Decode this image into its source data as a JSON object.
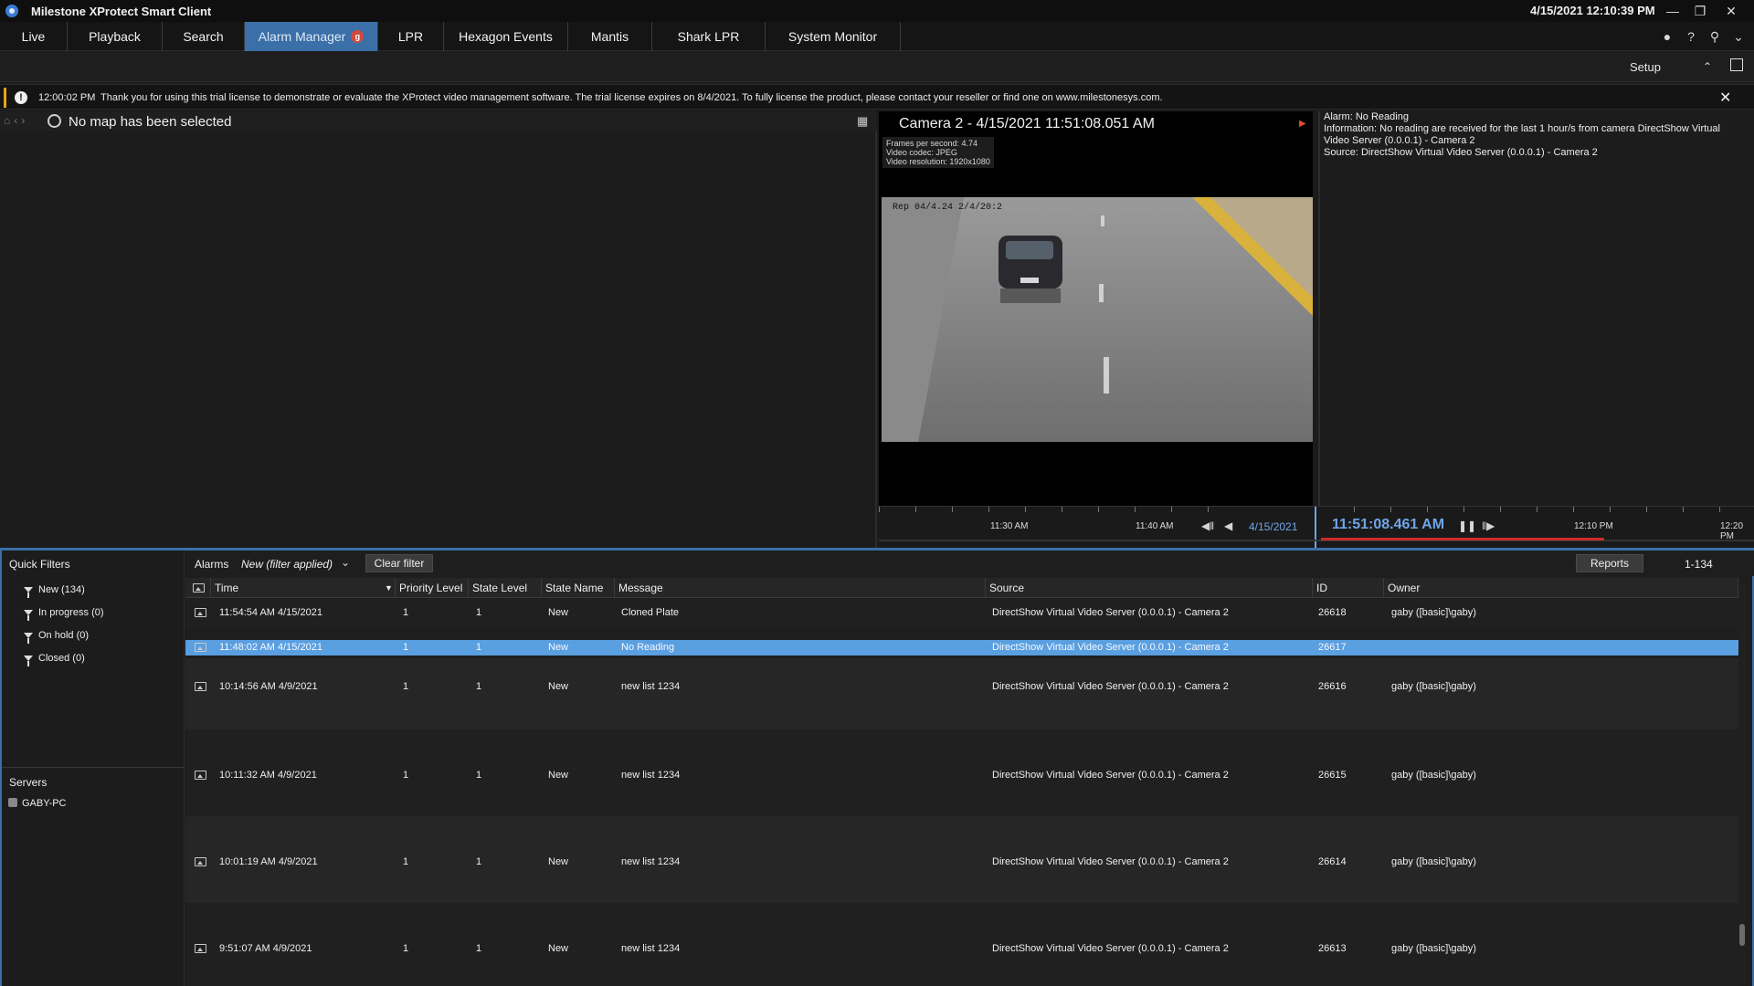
{
  "titlebar": {
    "title": "Milestone XProtect Smart Client",
    "clock": "4/15/2021 12:10:39 PM"
  },
  "tabs": [
    {
      "label": "Live"
    },
    {
      "label": "Playback"
    },
    {
      "label": "Search"
    },
    {
      "label": "Alarm Manager",
      "badge": "g"
    },
    {
      "label": "LPR"
    },
    {
      "label": "Hexagon Events"
    },
    {
      "label": "Mantis"
    },
    {
      "label": "Shark LPR"
    },
    {
      "label": "System Monitor"
    }
  ],
  "setup": {
    "label": "Setup"
  },
  "notification": {
    "time": "12:00:02 PM",
    "message": "Thank you for using this trial license to demonstrate or evaluate the XProtect video management software. The trial license expires on 8/4/2021. To fully license the product, please contact your reseller or find one on www.milestonesys.com."
  },
  "map": {
    "title": "No map has been selected"
  },
  "camera": {
    "title": "Camera 2 - 4/15/2021 11:51:08.051 AM",
    "fps": "Frames per second: 4.74",
    "codec": "Video codec: JPEG",
    "resolution": "Video resolution: 1920x1080",
    "overlay_text": "Rep 04/4.24 2/4/20:2"
  },
  "alarm_detail": {
    "line1": "Alarm: No Reading",
    "line2": "Information: No reading are received for the last 1 hour/s from camera DirectShow Virtual",
    "line3": "Video Server (0.0.0.1) - Camera 2",
    "line4": "Source: DirectShow Virtual Video Server (0.0.0.1) - Camera 2"
  },
  "timeline": {
    "labels": [
      "11:30 AM",
      "11:40 AM",
      "12:10 PM",
      "12:20 PM"
    ],
    "date": "4/15/2021",
    "current": "11:51:08.461 AM"
  },
  "quick_filters": {
    "title": "Quick Filters",
    "items": [
      "New (134)",
      "In progress (0)",
      "On hold (0)",
      "Closed (0)"
    ]
  },
  "servers": {
    "title": "Servers",
    "items": [
      "GABY-PC"
    ]
  },
  "alarm_toolbar": {
    "alarms_label": "Alarms",
    "filter_value": "New (filter applied)",
    "clear_filter": "Clear filter",
    "reports": "Reports",
    "range": "1-134"
  },
  "columns": [
    "Time",
    "Priority Level",
    "State Level",
    "State Name",
    "Message",
    "Source",
    "ID",
    "Owner"
  ],
  "rows": [
    {
      "time": "11:54:54 AM 4/15/2021",
      "priority": "1",
      "state_level": "1",
      "state_name": "New",
      "message": "Cloned Plate",
      "source": "DirectShow Virtual Video Server (0.0.0.1) - Camera 2",
      "id": "26618",
      "owner": "gaby ([basic]\\gaby)"
    },
    {
      "time": "11:48:02 AM 4/15/2021",
      "priority": "1",
      "state_level": "1",
      "state_name": "New",
      "message": "No Reading",
      "source": "DirectShow Virtual Video Server (0.0.0.1) - Camera 2",
      "id": "26617",
      "owner": ""
    },
    {
      "time": "10:14:56 AM 4/9/2021",
      "priority": "1",
      "state_level": "1",
      "state_name": "New",
      "message": "new list 1234",
      "source": "DirectShow Virtual Video Server (0.0.0.1) - Camera 2",
      "id": "26616",
      "owner": "gaby ([basic]\\gaby)"
    },
    {
      "time": "10:11:32 AM 4/9/2021",
      "priority": "1",
      "state_level": "1",
      "state_name": "New",
      "message": "new list 1234",
      "source": "DirectShow Virtual Video Server (0.0.0.1) - Camera 2",
      "id": "26615",
      "owner": "gaby ([basic]\\gaby)"
    },
    {
      "time": "10:01:19 AM 4/9/2021",
      "priority": "1",
      "state_level": "1",
      "state_name": "New",
      "message": "new list 1234",
      "source": "DirectShow Virtual Video Server (0.0.0.1) - Camera 2",
      "id": "26614",
      "owner": "gaby ([basic]\\gaby)"
    },
    {
      "time": "9:51:07 AM 4/9/2021",
      "priority": "1",
      "state_level": "1",
      "state_name": "New",
      "message": "new list 1234",
      "source": "DirectShow Virtual Video Server (0.0.0.1) - Camera 2",
      "id": "26613",
      "owner": "gaby ([basic]\\gaby)"
    }
  ]
}
